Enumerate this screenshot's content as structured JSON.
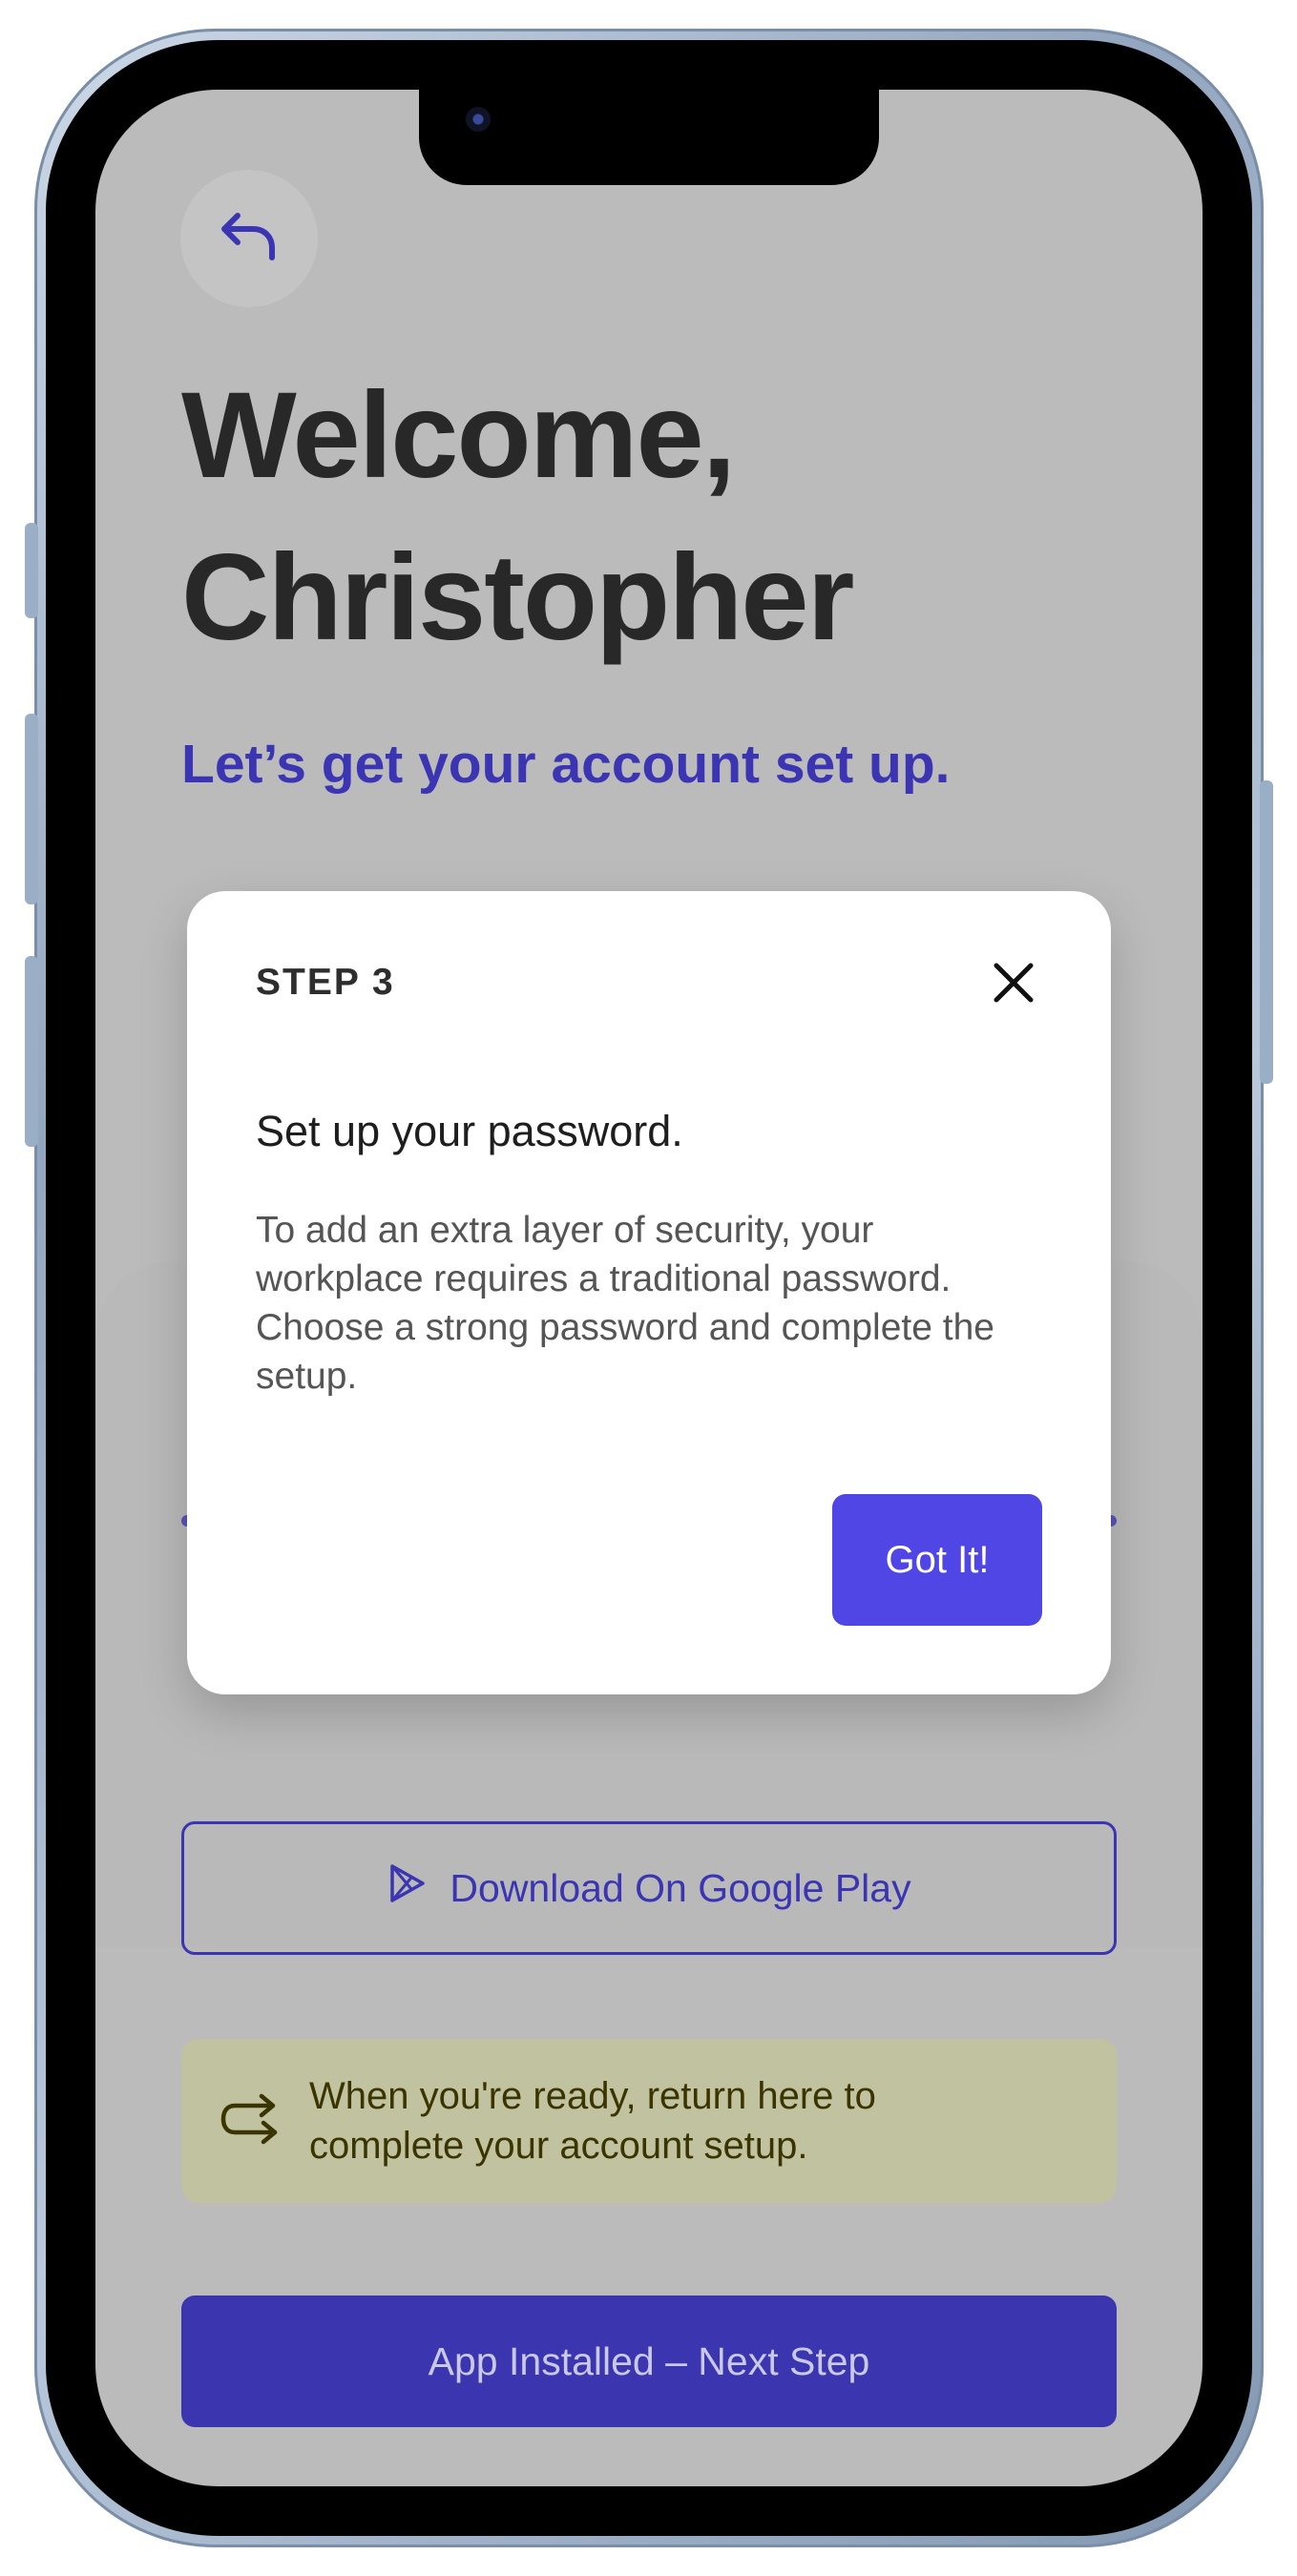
{
  "page": {
    "welcome_line1": "Welcome,",
    "welcome_line2": "Christopher",
    "subtitle": "Let’s get your account set up."
  },
  "modal": {
    "step_label": "STEP 3",
    "heading": "Set up your password.",
    "body": "To add an extra layer of security, your workplace requires a traditional password. Choose a strong password and complete the setup.",
    "confirm_label": "Got It!"
  },
  "actions": {
    "google_play_label": "Download On Google Play",
    "info_message": "When you're ready, return here to complete your account setup.",
    "next_step_label": "App Installed – Next Step"
  },
  "icons": {
    "back": "back-arrow-icon",
    "close": "close-icon",
    "play": "play-store-icon",
    "return": "return-arrow-icon"
  },
  "colors": {
    "accent": "#3b35b3",
    "modal_button": "#4f46e5",
    "overlay": "#bbbbbb",
    "info_background": "#c0c2a0"
  }
}
